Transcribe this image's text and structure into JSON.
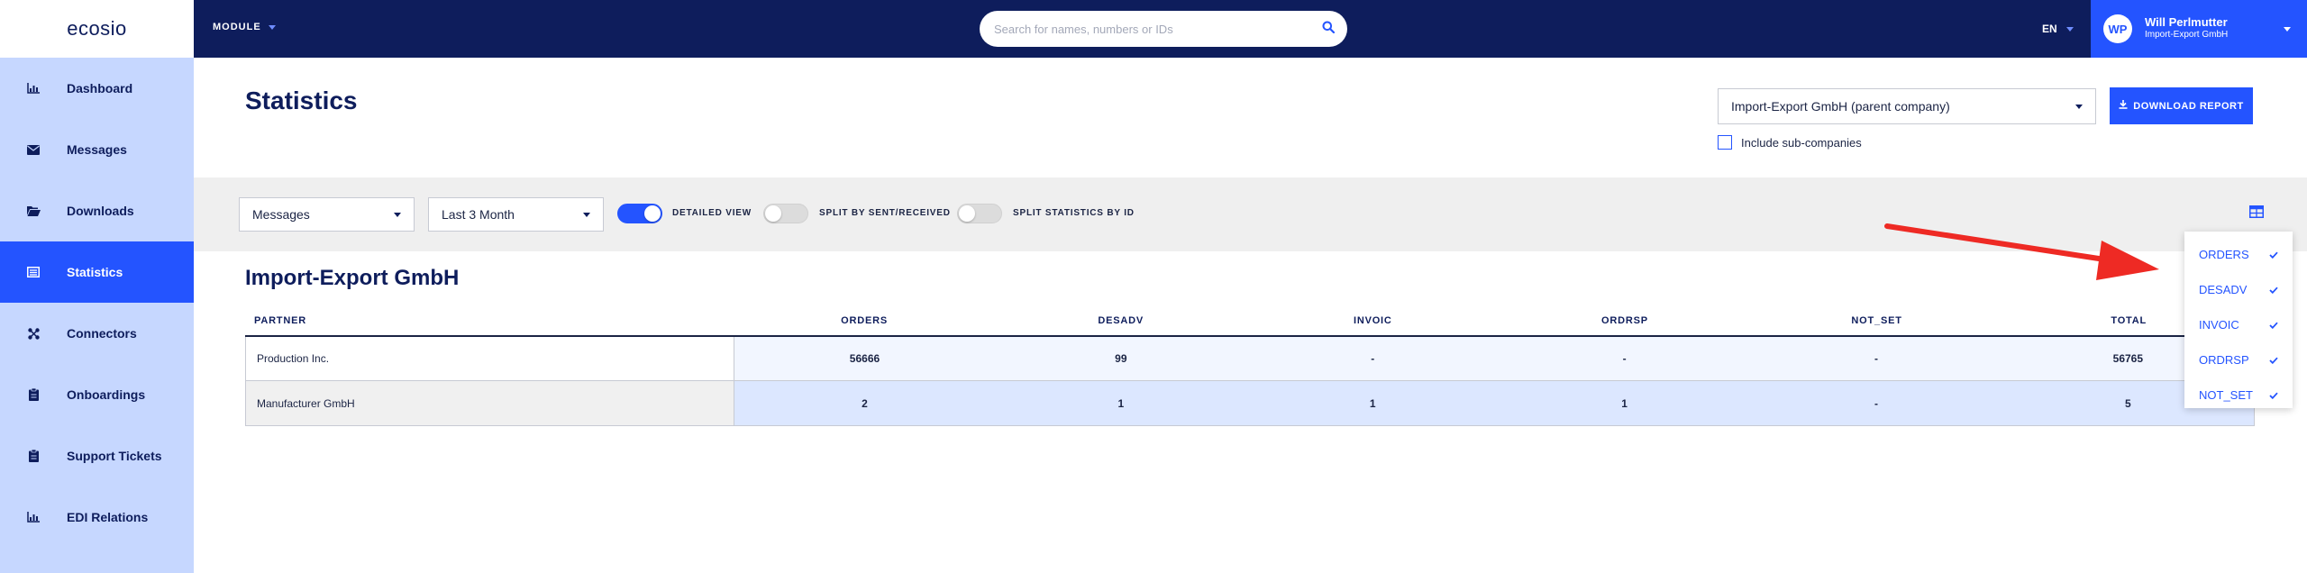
{
  "header": {
    "brand": "ecosio",
    "module_label": "MODULE",
    "search_placeholder": "Search for names, numbers or IDs",
    "language": "EN",
    "user": {
      "initials": "WP",
      "name": "Will Perlmutter",
      "company": "Import-Export GmbH"
    }
  },
  "sidebar": {
    "items": [
      {
        "label": "Dashboard",
        "icon": "bar-chart-icon",
        "active": false
      },
      {
        "label": "Messages",
        "icon": "envelope-icon",
        "active": false
      },
      {
        "label": "Downloads",
        "icon": "folder-open-icon",
        "active": false
      },
      {
        "label": "Statistics",
        "icon": "list-alt-icon",
        "active": true
      },
      {
        "label": "Connectors",
        "icon": "connectors-icon",
        "active": false
      },
      {
        "label": "Onboardings",
        "icon": "clipboard-icon",
        "active": false
      },
      {
        "label": "Support Tickets",
        "icon": "clipboard-icon",
        "active": false
      },
      {
        "label": "EDI Relations",
        "icon": "bar-chart-icon",
        "active": false
      }
    ]
  },
  "page": {
    "title": "Statistics",
    "company_select": "Import-Export GmbH (parent company)",
    "download_label": "DOWNLOAD REPORT",
    "include_subcompanies": "Include sub-companies",
    "include_subcompanies_checked": false
  },
  "filters": {
    "type_select": "Messages",
    "period_select": "Last 3 Month",
    "toggles": [
      {
        "label": "DETAILED VIEW",
        "on": true
      },
      {
        "label": "SPLIT BY SENT/RECEIVED",
        "on": false
      },
      {
        "label": "SPLIT STATISTICS BY ID",
        "on": false
      }
    ]
  },
  "section": {
    "title": "Import-Export GmbH"
  },
  "table": {
    "columns": [
      "PARTNER",
      "ORDERS",
      "DESADV",
      "INVOIC",
      "ORDRSP",
      "NOT_SET",
      "TOTAL"
    ],
    "rows": [
      [
        "Production Inc.",
        "56666",
        "99",
        "-",
        "-",
        "-",
        "56765"
      ],
      [
        "Manufacturer GmbH",
        "2",
        "1",
        "1",
        "1",
        "-",
        "5"
      ]
    ]
  },
  "column_menu": {
    "items": [
      {
        "label": "ORDERS",
        "checked": true
      },
      {
        "label": "DESADV",
        "checked": true
      },
      {
        "label": "INVOIC",
        "checked": true
      },
      {
        "label": "ORDRSP",
        "checked": true
      },
      {
        "label": "NOT_SET",
        "checked": true
      }
    ]
  },
  "colors": {
    "navy": "#0e1d5c",
    "accent": "#2454ff",
    "sidebar_bg": "#c6d7ff",
    "annotation_arrow": "#ee2a24"
  }
}
